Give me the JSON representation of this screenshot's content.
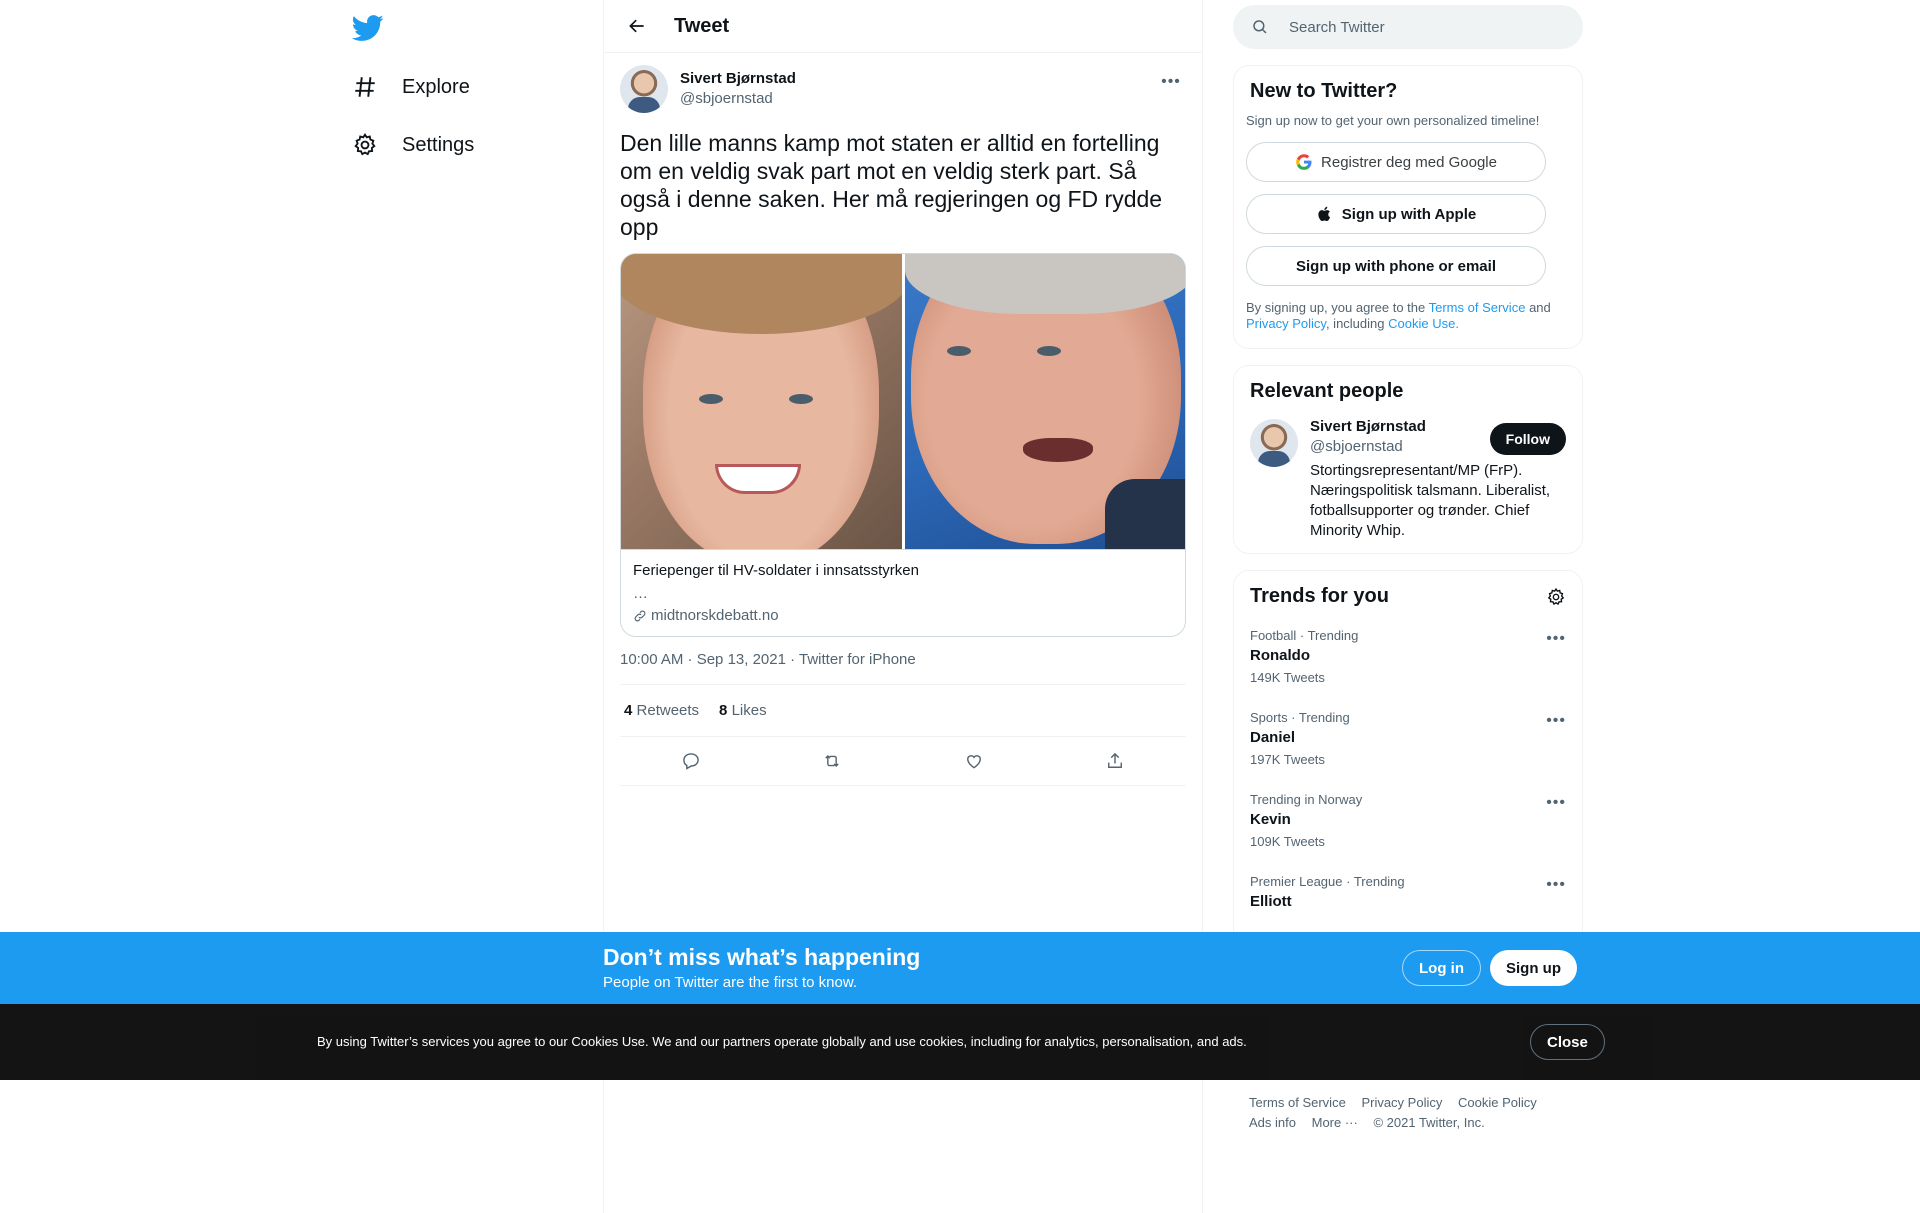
{
  "nav": {
    "explore": "Explore",
    "settings": "Settings"
  },
  "header": {
    "title": "Tweet"
  },
  "tweet": {
    "author_name": "Sivert Bjørnstad",
    "author_handle": "@sbjoernstad",
    "text": "Den lille manns kamp mot staten er alltid en fortelling om en veldig svak part mot en veldig sterk part. Så også i denne saken. Her må regjeringen og FD rydde opp",
    "card": {
      "title": "Feriepenger til HV-soldater i innsatsstyrken",
      "description": "…",
      "domain": "midtnorskdebatt.no"
    },
    "timestamp": "10:00 AM · Sep 13, 2021 · Twitter for iPhone",
    "retweets_count": "4",
    "retweets_label": "Retweets",
    "likes_count": "8",
    "likes_label": "Likes"
  },
  "search": {
    "placeholder": "Search Twitter"
  },
  "signup": {
    "title": "New to Twitter?",
    "subtitle": "Sign up now to get your own personalized timeline!",
    "google": "Registrer deg med Google",
    "apple": "Sign up with Apple",
    "phone": "Sign up with phone or email",
    "legal_prefix": "By signing up, you agree to the",
    "terms": "Terms of Service",
    "and": "and",
    "privacy": "Privacy Policy",
    "including": ", including",
    "cookie": "Cookie Use."
  },
  "relevant": {
    "title": "Relevant people",
    "name": "Sivert Bjørnstad",
    "handle": "@sbjoernstad",
    "bio": "Stortingsrepresentant/MP (FrP). Næringspolitisk talsmann. Liberalist, fotballsupporter og trønder. Chief Minority Whip.",
    "follow": "Follow"
  },
  "trends": {
    "title": "Trends for you",
    "items": [
      {
        "meta": "Football · Trending",
        "name": "Ronaldo",
        "count": "149K Tweets"
      },
      {
        "meta": "Sports · Trending",
        "name": "Daniel",
        "count": "197K Tweets"
      },
      {
        "meta": "Trending in Norway",
        "name": "Kevin",
        "count": "109K Tweets"
      },
      {
        "meta": "Premier League · Trending",
        "name": "Elliott",
        "count": ""
      }
    ]
  },
  "footer": {
    "terms": "Terms of Service",
    "privacy": "Privacy Policy",
    "cookie": "Cookie Policy",
    "ads": "Ads info",
    "more": "More ···",
    "copyright": "© 2021 Twitter, Inc."
  },
  "promo": {
    "title": "Don’t miss what’s happening",
    "subtitle": "People on Twitter are the first to know.",
    "login": "Log in",
    "signup": "Sign up"
  },
  "cookie_bar": {
    "text": "By using Twitter’s services you agree to our Cookies Use. We and our partners operate globally and use cookies, including for analytics, personalisation, and ads.",
    "close": "Close"
  },
  "colors": {
    "brand": "#1d9bf0",
    "text": "#0f1419",
    "muted": "#536471"
  }
}
